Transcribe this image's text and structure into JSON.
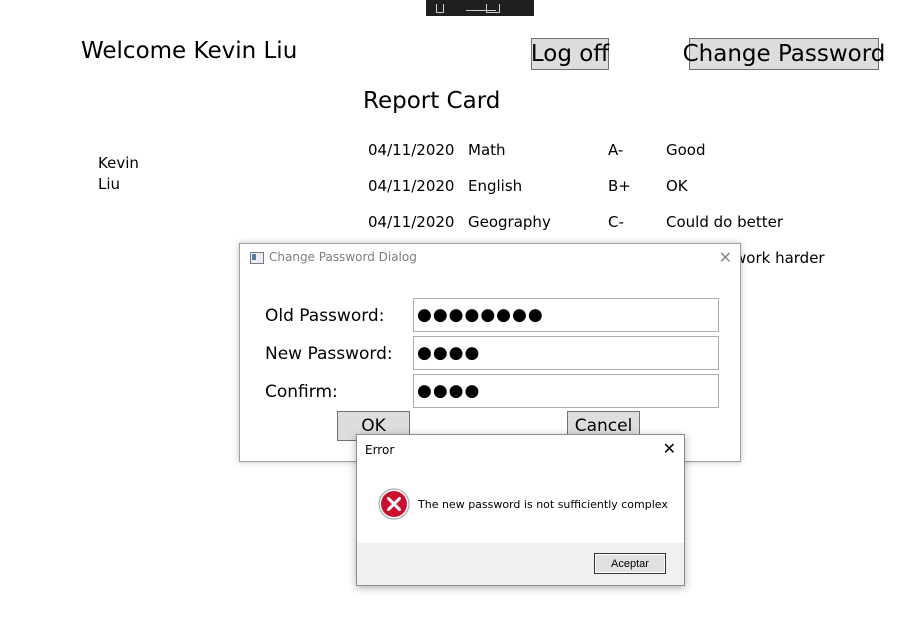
{
  "header": {
    "welcome": "Welcome Kevin Liu",
    "logoff_label": "Log off",
    "change_password_label": "Change Password"
  },
  "report": {
    "title": "Report Card",
    "student_name": "Kevin\nLiu",
    "rows": [
      {
        "date": "04/11/2020",
        "subject": "Math",
        "grade": "A-",
        "comment": "Good"
      },
      {
        "date": "04/11/2020",
        "subject": "English",
        "grade": "B+",
        "comment": "OK"
      },
      {
        "date": "04/11/2020",
        "subject": "Geography",
        "grade": "C-",
        "comment": "Could do better"
      },
      {
        "date": "",
        "subject": "",
        "grade": "",
        "comment": "work harder"
      }
    ]
  },
  "dialog": {
    "title": "Change Password Dialog",
    "close_icon": "close-icon",
    "old_label": "Old Password:",
    "new_label": "New Password:",
    "confirm_label": "Confirm:",
    "old_value": "●●●●●●●●",
    "new_value": "●●●●",
    "confirm_value": "●●●●",
    "ok_label": "OK",
    "cancel_label": "Cancel"
  },
  "error_box": {
    "title": "Error",
    "message": "The new password is not sufficiently complex",
    "button_label": "Aceptar",
    "icon": "error-icon",
    "icon_color": "#c8102e"
  }
}
